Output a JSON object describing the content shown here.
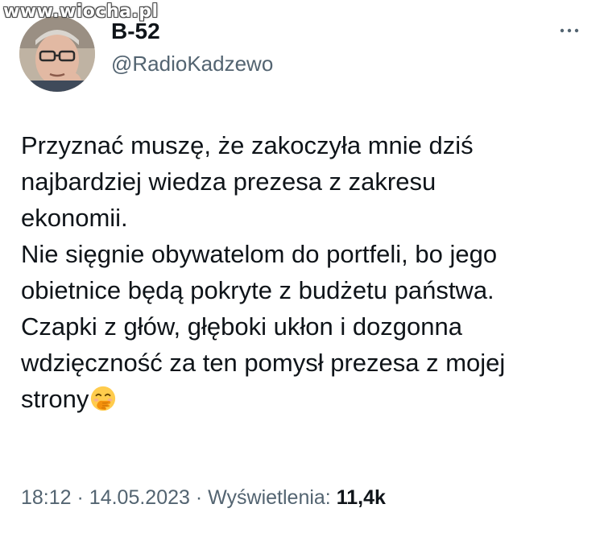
{
  "watermark": "www.wiocha.pl",
  "author": {
    "display_name": "B-52",
    "handle": "@RadioKadzewo"
  },
  "more_icon": "more-dots-icon",
  "tweet": {
    "lines": [
      "Przyznać muszę, że zakoczyła mnie dziś",
      "najbardziej wiedza prezesa z zakresu",
      "ekonomii.",
      "Nie sięgnie obywatelom do portfeli, bo jego",
      "obietnice będą pokryte z budżetu państwa.",
      "Czapki z głów, głęboki ukłon i dozgonna",
      "wdzięczność za ten pomysł prezesa z mojej",
      "strony"
    ],
    "emoji": "hand-over-mouth-emoji"
  },
  "meta": {
    "time": "18:12",
    "separator": "·",
    "date": "14.05.2023",
    "views_label": "Wyświetlenia:",
    "views_count": "11,4k"
  },
  "colors": {
    "text": "#0f1419",
    "secondary": "#536471",
    "background": "#ffffff"
  }
}
